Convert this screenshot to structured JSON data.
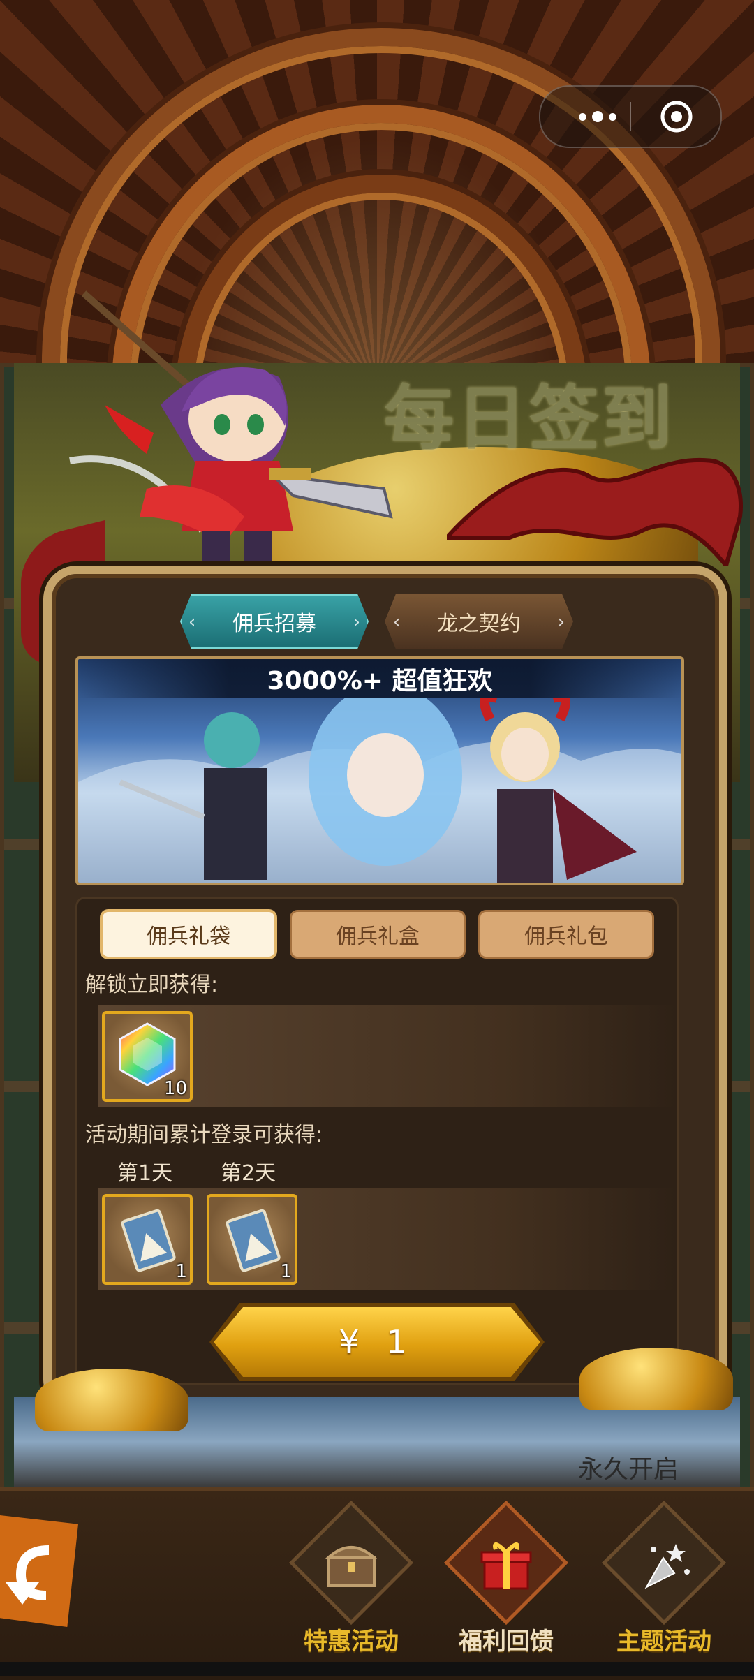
{
  "banner": {
    "title": "每日签到"
  },
  "tabs": [
    {
      "label": "佣兵招募",
      "active": true
    },
    {
      "label": "龙之契约",
      "active": false
    }
  ],
  "promo": {
    "caption": "3000%+ 超值狂欢"
  },
  "options": [
    {
      "label": "佣兵礼袋",
      "selected": true
    },
    {
      "label": "佣兵礼盒",
      "selected": false
    },
    {
      "label": "佣兵礼包",
      "selected": false
    }
  ],
  "unlock": {
    "label": "解锁立即获得:",
    "items": [
      {
        "icon": "rainbow-gem-icon",
        "qty": "10"
      }
    ]
  },
  "login_rewards": {
    "label": "活动期间累计登录可获得:",
    "days": [
      {
        "day": "第1天",
        "icon": "card-ticket-icon",
        "qty": "1"
      },
      {
        "day": "第2天",
        "icon": "card-ticket-icon",
        "qty": "1"
      }
    ]
  },
  "purchase": {
    "price_label": "¥ 1"
  },
  "footer": {
    "duration": "永久开启"
  },
  "bottom_nav": [
    {
      "label": "特惠活动",
      "icon": "treasure-chest-icon"
    },
    {
      "label": "福利回馈",
      "icon": "gift-box-icon"
    },
    {
      "label": "主题活动",
      "icon": "party-popper-icon"
    }
  ],
  "colors": {
    "accent_teal": "#1a6c72",
    "gold": "#e0a010",
    "frame": "#c5a46a"
  }
}
